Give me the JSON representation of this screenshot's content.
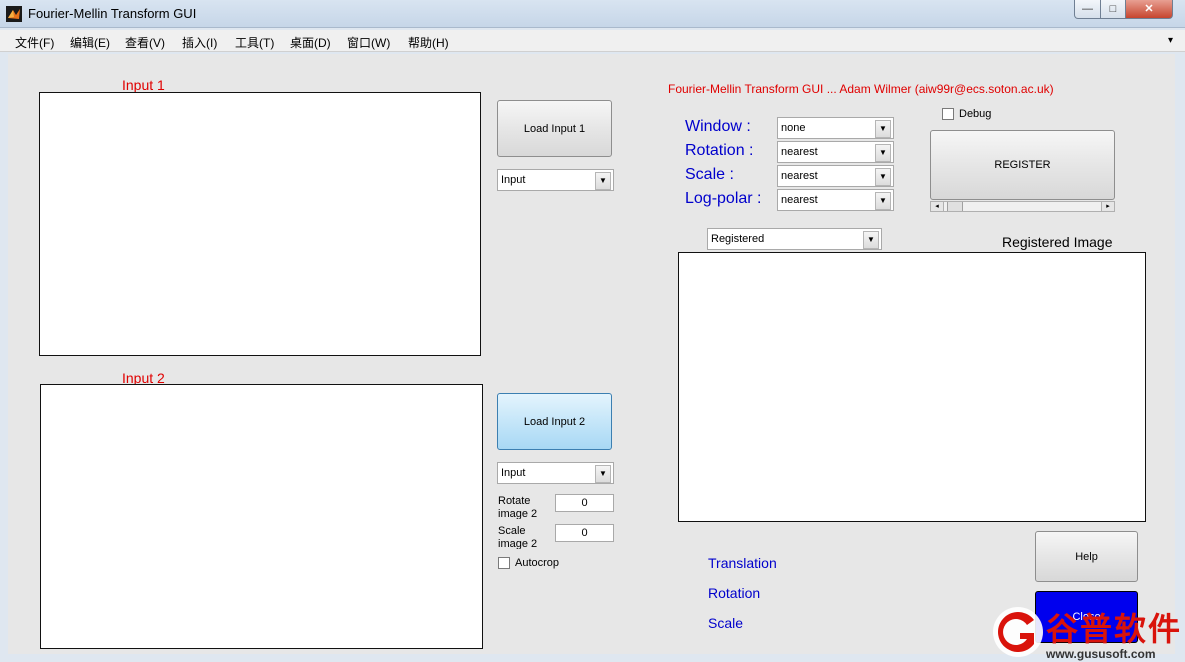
{
  "window": {
    "title": "Fourier-Mellin Transform GUI",
    "buttons": {
      "minimize": "—",
      "maximize": "□",
      "close": "✕"
    }
  },
  "menubar": {
    "items": [
      "文件(F)",
      "编辑(E)",
      "查看(V)",
      "插入(I)",
      "工具(T)",
      "桌面(D)",
      "窗口(W)",
      "帮助(H)"
    ],
    "overflow": "▾"
  },
  "input1": {
    "title": "Input 1",
    "load_button": "Load Input 1",
    "view_select": "Input"
  },
  "input2": {
    "title": "Input 2",
    "load_button": "Load Input 2",
    "view_select": "Input",
    "rotate_label": "Rotate image 2",
    "rotate_value": "0",
    "scale_label": "Scale image 2",
    "scale_value": "0",
    "autocrop_label": "Autocrop",
    "autocrop_checked": false
  },
  "header": {
    "credit": "Fourier-Mellin Transform GUI ... Adam Wilmer (aiw99r@ecs.soton.ac.uk)"
  },
  "options": {
    "window_label": "Window :",
    "window_value": "none",
    "rotation_label": "Rotation :",
    "rotation_value": "nearest",
    "scale_label": "Scale :",
    "scale_value": "nearest",
    "logpolar_label": "Log-polar :",
    "logpolar_value": "nearest"
  },
  "register": {
    "debug_label": "Debug",
    "debug_checked": false,
    "button": "REGISTER"
  },
  "output": {
    "view_select": "Registered",
    "title": "Registered Image",
    "translation_label": "Translation",
    "rotation_label": "Rotation",
    "scale_label": "Scale",
    "help_button": "Help",
    "close_button": "Close"
  },
  "watermark": {
    "brand": "谷普软件",
    "url": "www.gususoft.com"
  },
  "colors": {
    "accent_red": "#e00000",
    "label_blue": "#0000cc",
    "close_button": "#0000ee",
    "hot_button": "#a8d8f4"
  }
}
